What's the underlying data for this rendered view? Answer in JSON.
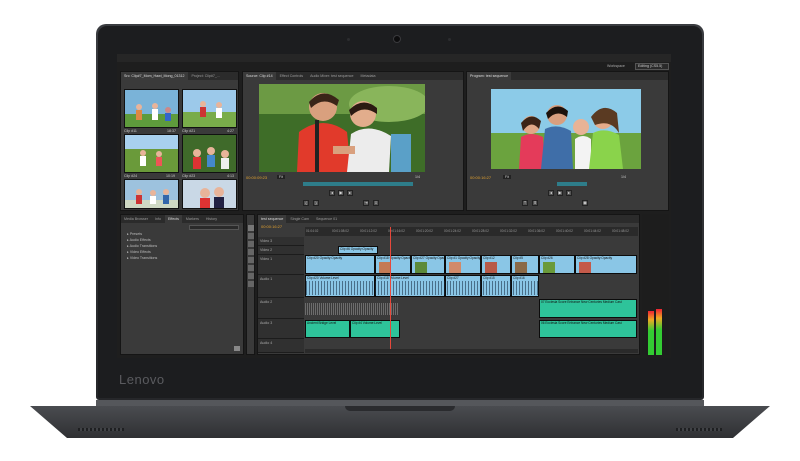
{
  "device": {
    "brand": "Lenovo"
  },
  "app": {
    "workspace_label": "Workspace",
    "workspace_value": "Editing (CS5.5)"
  },
  "project_panel": {
    "tabs": [
      "Src: Clip#7_Mom_Hawi_Mong_01312",
      "Project: Clip#7_...",
      "Br..."
    ],
    "clips": [
      {
        "name": "Clip #11",
        "duration": "18:37"
      },
      {
        "name": "Clip #21",
        "duration": "4:27"
      },
      {
        "name": "Clip #24",
        "duration": "10:19"
      },
      {
        "name": "Clip #23",
        "duration": "4:13"
      },
      {
        "name": "Clip #19",
        "duration": "12:15"
      },
      {
        "name": "Clip #3",
        "duration": "07:08"
      }
    ]
  },
  "source_monitor": {
    "tabs": [
      "Source: Clip #14",
      "Effect Controls",
      "Audio Mixer: test sequence",
      "Metadata"
    ],
    "timecode": "00:00:09:23",
    "fit": "Fit",
    "zoom": "1/4"
  },
  "program_monitor": {
    "tabs": [
      "Program: test sequence"
    ],
    "timecode": "00:00:16:27",
    "fit": "Fit",
    "zoom": "1/4"
  },
  "effects_panel": {
    "tabs": [
      "Media Browser",
      "Info",
      "Effects",
      "Markers",
      "History"
    ],
    "items": [
      "Presets",
      "Audio Effects",
      "Audio Transitions",
      "Video Effects",
      "Video Transitions"
    ]
  },
  "timeline": {
    "tabs": [
      "test sequence",
      "Single Cam",
      "Sequence 01"
    ],
    "timecode": "00:00:16:27",
    "ruler": [
      "01:04:02",
      "00:01:08:02",
      "00:01:12:02",
      "00:01:16:02",
      "00:01:20:02",
      "00:01:24:02",
      "00:01:28:02",
      "00:01:32:02",
      "00:01:36:02",
      "00:01:40:02",
      "00:01:44:02",
      "00:01:48:02"
    ],
    "tracks": [
      {
        "name": "Video 3"
      },
      {
        "name": "Video 2"
      },
      {
        "name": "Video 1"
      },
      {
        "name": "Audio 1"
      },
      {
        "name": "Audio 2"
      },
      {
        "name": "Audio 3"
      },
      {
        "name": "Audio 4"
      }
    ],
    "clips": {
      "v2": "Clip #6 Opacity:Opacity",
      "v1a": "Clip #20 Opacity:Opacity",
      "v1b": "Clip #18 Opacity:Opacity",
      "v1c": "Clip #27 Opacity:Opacity",
      "v1d": "Clip #1 Opacity:Opacity",
      "v1e": "Clip #12",
      "v1f": "Clip #5",
      "v1g": "Clip #26",
      "v1h": "Clip #28 Opacity:Opacity",
      "a1a": "Clip #20 Volume:Level",
      "a1b": "Clip #18 Volume:Level",
      "a1c": "Clip #27",
      "a1d": "Clip #15",
      "a1e": "Clip #16",
      "a2a": "07 Ecclesia Score Entrance New Centuries Medium Cast",
      "a2b": "06 Ecclesia Score Entrance New Centuries Medium Cast",
      "a3a": "Ancient Bridge Level",
      "a3b": "Clip #4 Volume:Level"
    }
  },
  "colors": {
    "video_clip": "#8ac6e6",
    "audio_score_clip": "#2ec39a",
    "timecode": "#e0a030",
    "playhead": "#e6483b"
  }
}
